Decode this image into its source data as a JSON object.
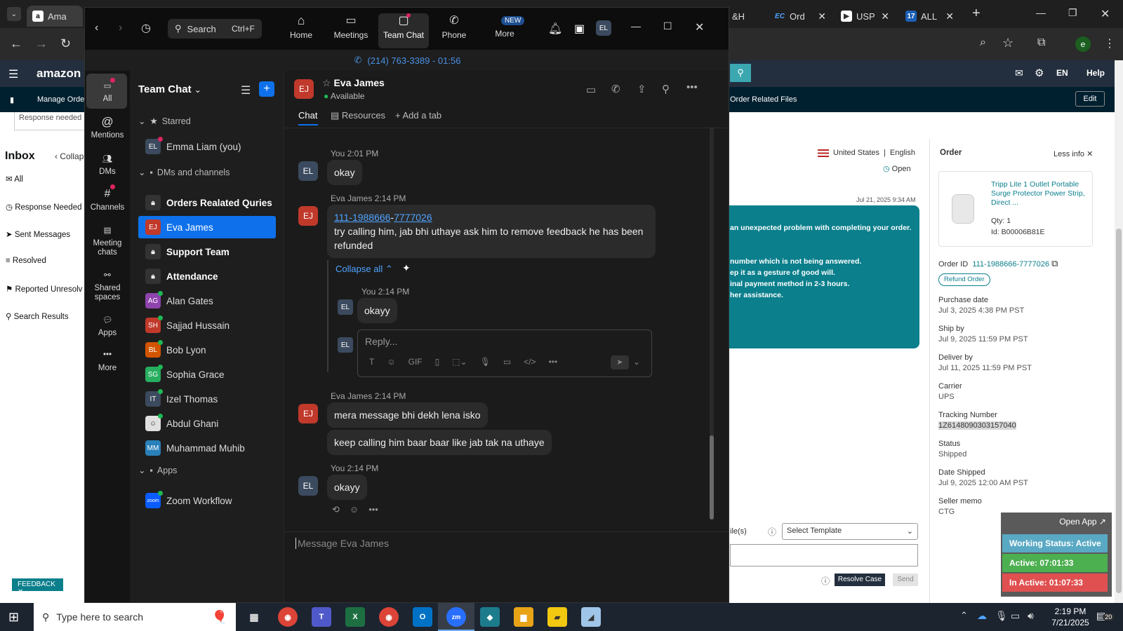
{
  "chrome": {
    "tabs": [
      {
        "label": "Ama",
        "icon": "amazon-icon"
      },
      {
        "label": "&H",
        "icon": ""
      },
      {
        "label": "Ord",
        "icon": "ec-icon"
      },
      {
        "label": "USP",
        "icon": "usps-icon"
      },
      {
        "label": "ALL",
        "icon": "17track-icon"
      }
    ],
    "profile": "e"
  },
  "amazon": {
    "nav": {
      "logo": "amazon se",
      "lang": "EN",
      "help": "Help"
    },
    "subnav": {
      "manage_order": "Manage Order",
      "order_files": "Order Related Files",
      "edit": "Edit"
    },
    "response_needed_box": "Response needed",
    "sidebar": {
      "title": "Inbox",
      "collapse": "Collap",
      "items": [
        "All",
        "Response Needed",
        "Sent Messages",
        "Resolved",
        "Reported Unresolv",
        "Search Results"
      ]
    },
    "locale": {
      "country": "United States",
      "sep": "|",
      "lang": "English"
    },
    "open_status": "Open",
    "message": {
      "timestamp": "Jul 21, 2025 9:34 AM",
      "line1": "an unexpected problem with completing your order.",
      "line2": "number which is not being answered.",
      "line3": "ep it as a gesture of good will.",
      "line4": "inal payment method in 2-3 hours.",
      "line5": "her assistance."
    },
    "compose": {
      "file_label": "ile(s)",
      "template_placeholder": "Select Template",
      "resolve": "Resolve Case",
      "send": "Send"
    },
    "feedback": "FEEDBACK",
    "order_panel": {
      "title": "Order",
      "less_info": "Less info",
      "product_title": "Tripp Lite 1 Outlet Portable Surge Protector Power Strip, Direct ...",
      "qty_label": "Qty:",
      "qty": "1",
      "id_label": "Id:",
      "asin": "B00006B81E",
      "order_id_label": "Order ID",
      "order_id": "111-1988666-7777026",
      "refund_btn": "Refund Order",
      "fields": [
        {
          "label": "Purchase date",
          "value": "Jul 3, 2025 4:38 PM PST"
        },
        {
          "label": "Ship by",
          "value": "Jul 9, 2025 11:59 PM PST"
        },
        {
          "label": "Deliver by",
          "value": "Jul 11, 2025 11:59 PM PST"
        },
        {
          "label": "Carrier",
          "value": "UPS"
        },
        {
          "label": "Tracking Number",
          "value": "1Z6148090303157040"
        },
        {
          "label": "Status",
          "value": "Shipped"
        },
        {
          "label": "Date Shipped",
          "value": "Jul 9, 2025 12:00 AM PST"
        },
        {
          "label": "Seller memo",
          "value": "CTG"
        }
      ]
    }
  },
  "timer": {
    "open_app": "Open App ↗",
    "working": "Working Status: Active",
    "active": "Active: 07:01:33",
    "inactive": "In Active: 01:07:33"
  },
  "zoom": {
    "search": {
      "label": "Search",
      "shortcut": "Ctrl+F"
    },
    "nav": [
      {
        "label": "Home"
      },
      {
        "label": "Meetings"
      },
      {
        "label": "Team Chat"
      },
      {
        "label": "Phone"
      },
      {
        "label": "More",
        "badge": "NEW"
      }
    ],
    "user_initials": "EL",
    "call_bar": "(214) 763-3389 - 01:56",
    "rail": [
      "All",
      "Mentions",
      "DMs",
      "Channels",
      "Meeting chats",
      "Shared spaces",
      "Apps",
      "More"
    ],
    "list_title": "Team Chat",
    "sections": {
      "starred": "Starred",
      "dms": "DMs and channels",
      "apps": "Apps"
    },
    "starred": [
      {
        "initials": "EL",
        "name": "Emma Liam (you)",
        "color": "#3b4a5e"
      }
    ],
    "channels": [
      {
        "initials": "",
        "name": "Orders Realated Quries",
        "type": "lock",
        "bold": true
      },
      {
        "initials": "EJ",
        "name": "Eva James",
        "type": "dm",
        "color": "#c0392b",
        "selected": true
      },
      {
        "initials": "",
        "name": "Support Team",
        "type": "lock",
        "bold": true
      },
      {
        "initials": "",
        "name": "Attendance",
        "type": "lock",
        "bold": true
      },
      {
        "initials": "AG",
        "name": "Alan Gates",
        "type": "dm",
        "color": "#8e44ad"
      },
      {
        "initials": "SH",
        "name": "Sajjad Hussain",
        "type": "dm",
        "color": "#c0392b"
      },
      {
        "initials": "BL",
        "name": "Bob Lyon",
        "type": "dm",
        "color": "#d35400"
      },
      {
        "initials": "SG",
        "name": "Sophia Grace",
        "type": "dm",
        "color": "#27ae60"
      },
      {
        "initials": "IT",
        "name": "Izel Thomas",
        "type": "dm",
        "color": "#3b4a5e"
      },
      {
        "initials": "",
        "name": "Abdul Ghani",
        "type": "photo",
        "color": "#e0e0e0"
      },
      {
        "initials": "MM",
        "name": "Muhammad Muhib",
        "type": "dm",
        "color": "#2980b9"
      }
    ],
    "apps": [
      {
        "initials": "zoom",
        "name": "Zoom Workflow",
        "color": "#0b5cff"
      }
    ],
    "chat_header": {
      "initials": "EJ",
      "name": "Eva James",
      "status": "Available"
    },
    "chat_tabs": {
      "chat": "Chat",
      "resources": "Resources",
      "add": "Add a tab"
    },
    "messages": {
      "m1_meta": "You 2:01 PM",
      "m1_text": "okay",
      "m2_meta": "Eva James 2:14 PM",
      "m2_link1": "111-1988666",
      "m2_dash": "-",
      "m2_link2": "7777026",
      "m2_text": "try calling him, jab bhi uthaye ask him to remove feedback he has been refunded",
      "collapse": "Collapse all",
      "r1_meta": "You 2:14 PM",
      "r1_text": "okayy",
      "reply_placeholder": "Reply...",
      "m3_meta": "Eva James 2:14 PM",
      "m3_text1": "mera message bhi dekh lena isko",
      "m3_text2": "keep calling him baar baar like jab tak na uthaye",
      "m4_meta": "You 2:14 PM",
      "m4_text": "okayy",
      "compose_placeholder": "Message Eva James"
    }
  },
  "taskbar": {
    "search_placeholder": "Type here to search",
    "time": "2:19 PM",
    "date": "7/21/2025",
    "notif": "20"
  },
  "colors": {
    "zoom_blue": "#0e71eb",
    "amazon_teal": "#0b7f8c",
    "active_green": "#4caf50",
    "inactive_red": "#e05050"
  }
}
